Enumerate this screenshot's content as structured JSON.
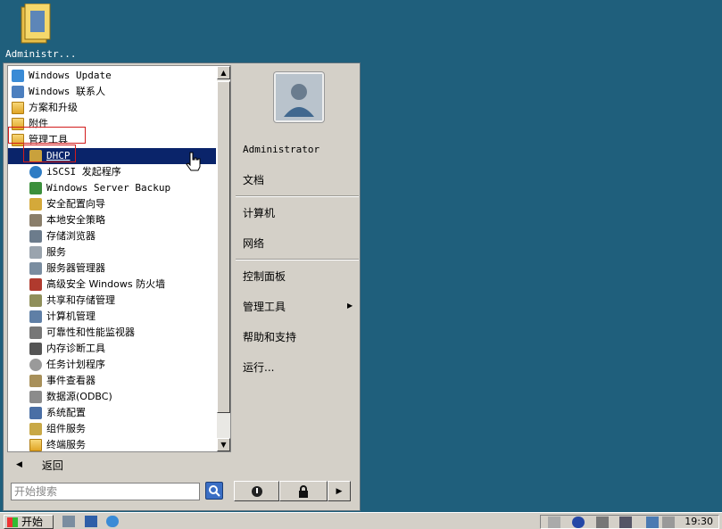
{
  "desktop": {
    "icons": [
      {
        "label": "Administr...",
        "icon": "folder-user-icon"
      }
    ]
  },
  "start_menu": {
    "programs": [
      {
        "label": "Windows Update",
        "icon": "windows-update-icon",
        "level": 0
      },
      {
        "label": "Windows 联系人",
        "icon": "contacts-icon",
        "level": 0
      },
      {
        "label": "方案和升级",
        "icon": "folder-icon",
        "level": 0
      },
      {
        "label": "附件",
        "icon": "folder-icon",
        "level": 0
      },
      {
        "label": "管理工具",
        "icon": "folder-icon",
        "level": 0
      },
      {
        "label": "DHCP",
        "icon": "dhcp-icon",
        "level": 1,
        "selected": true
      },
      {
        "label": "iSCSI 发起程序",
        "icon": "globe-icon",
        "level": 1
      },
      {
        "label": "Windows Server Backup",
        "icon": "backup-icon",
        "level": 1
      },
      {
        "label": "安全配置向导",
        "icon": "security-wizard-icon",
        "level": 1
      },
      {
        "label": "本地安全策略",
        "icon": "local-policy-icon",
        "level": 1
      },
      {
        "label": "存储浏览器",
        "icon": "storage-icon",
        "level": 1
      },
      {
        "label": "服务",
        "icon": "services-gear-icon",
        "level": 1
      },
      {
        "label": "服务器管理器",
        "icon": "server-manager-icon",
        "level": 1
      },
      {
        "label": "高级安全 Windows 防火墙",
        "icon": "firewall-icon",
        "level": 1
      },
      {
        "label": "共享和存储管理",
        "icon": "share-storage-icon",
        "level": 1
      },
      {
        "label": "计算机管理",
        "icon": "computer-management-icon",
        "level": 1
      },
      {
        "label": "可靠性和性能监视器",
        "icon": "performance-monitor-icon",
        "level": 1
      },
      {
        "label": "内存诊断工具",
        "icon": "memory-diagnostic-icon",
        "level": 1
      },
      {
        "label": "任务计划程序",
        "icon": "clock-icon",
        "level": 1
      },
      {
        "label": "事件查看器",
        "icon": "event-viewer-icon",
        "level": 1
      },
      {
        "label": "数据源(ODBC)",
        "icon": "odbc-icon",
        "level": 1
      },
      {
        "label": "系统配置",
        "icon": "system-config-icon",
        "level": 1
      },
      {
        "label": "组件服务",
        "icon": "component-services-icon",
        "level": 1
      },
      {
        "label": "终端服务",
        "icon": "folder-icon",
        "level": 1
      }
    ],
    "back_label": "返回",
    "search_placeholder": "开始搜索",
    "right_items": {
      "user": "Administrator",
      "documents": "文档",
      "computer": "计算机",
      "network": "网络",
      "control_panel": "控制面板",
      "admin_tools": "管理工具",
      "help": "帮助和支持",
      "run": "运行..."
    },
    "power_icons": {
      "power": "power-icon",
      "lock": "lock-icon",
      "more": "arrow-right-icon"
    }
  },
  "taskbar": {
    "start_label": "开始",
    "clock": "19:30"
  },
  "colors": {
    "desktop": "#1f5f7c",
    "selection": "#0a246a",
    "highlight_box": "#d21c1c"
  }
}
